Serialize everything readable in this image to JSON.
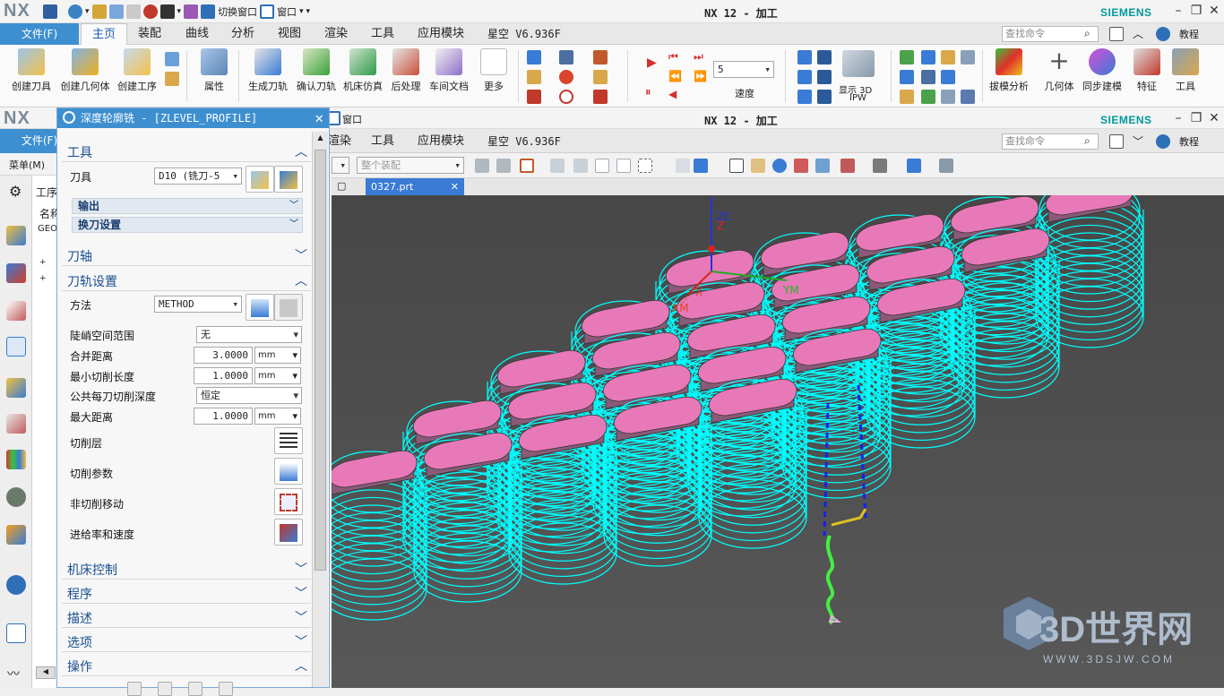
{
  "app": {
    "logo": "NX",
    "window_title": "NX 12 - 加工",
    "brand": "SIEMENS"
  },
  "qat": {
    "switch_window": "切换窗口",
    "window": "窗口"
  },
  "menu": {
    "file": "文件(F)",
    "tabs": [
      "主页",
      "装配",
      "曲线",
      "分析",
      "视图",
      "渲染",
      "工具",
      "应用模块",
      "星空 V6.936F"
    ],
    "inner_tabs": [
      "渲染",
      "工具",
      "应用模块",
      "星空 V6.936F"
    ],
    "search_placeholder": "查找命令",
    "tutorial": "教程"
  },
  "ribbon": {
    "buttons": [
      "创建刀具",
      "创建几何体",
      "创建工序",
      "属性",
      "生成刀轨",
      "确认刀轨",
      "机床仿真",
      "后处理",
      "车间文档",
      "更多"
    ],
    "speed_value": "5",
    "speed_label": "速度",
    "show_3d": "显示 3D",
    "ipw": "IPW",
    "right_buttons": [
      "拔模分析",
      "几何体",
      "同步建模",
      "特征",
      "工具"
    ]
  },
  "toolbar2": {
    "assembly_filter": "整个装配",
    "menu": "菜单(M)"
  },
  "document": {
    "tab": "0327.prt"
  },
  "navigator": {
    "title": "工序",
    "col_name": "名称",
    "row1": "GEOM"
  },
  "dialog": {
    "title": "深度轮廓铣 - [ZLEVEL_PROFILE]",
    "sections": {
      "tool": "工具",
      "tool_axis": "刀轴",
      "path_settings": "刀轨设置",
      "machine_control": "机床控制",
      "program": "程序",
      "description": "描述",
      "options": "选项",
      "actions": "操作"
    },
    "tool_label": "刀具",
    "tool_value": "D10 (铣刀-5",
    "output": "输出",
    "tool_change": "换刀设置",
    "method_label": "方法",
    "method_value": "METHOD",
    "steep_label": "陡峭空间范围",
    "steep_value": "无",
    "merge_label": "合并距离",
    "merge_value": "3.0000",
    "mincut_label": "最小切削长度",
    "mincut_value": "1.0000",
    "depth_label": "公共每刀切削深度",
    "depth_value": "恒定",
    "maxdist_label": "最大距离",
    "maxdist_value": "1.0000",
    "unit": "mm",
    "cut_levels": "切削层",
    "cut_params": "切削参数",
    "non_cut": "非切削移动",
    "feeds": "进给率和速度"
  },
  "viewport": {
    "axes": {
      "zc": "ZC",
      "z": "Z",
      "x": "X",
      "ym": "YM",
      "xm": "XM"
    },
    "watermark": "3D世界网",
    "watermark_url": "WWW.3DSJW.COM"
  },
  "colors": {
    "accent": "#3d8fd0",
    "toolpath": "#00ffff",
    "part": "#e879b8",
    "siemens": "#009999"
  }
}
